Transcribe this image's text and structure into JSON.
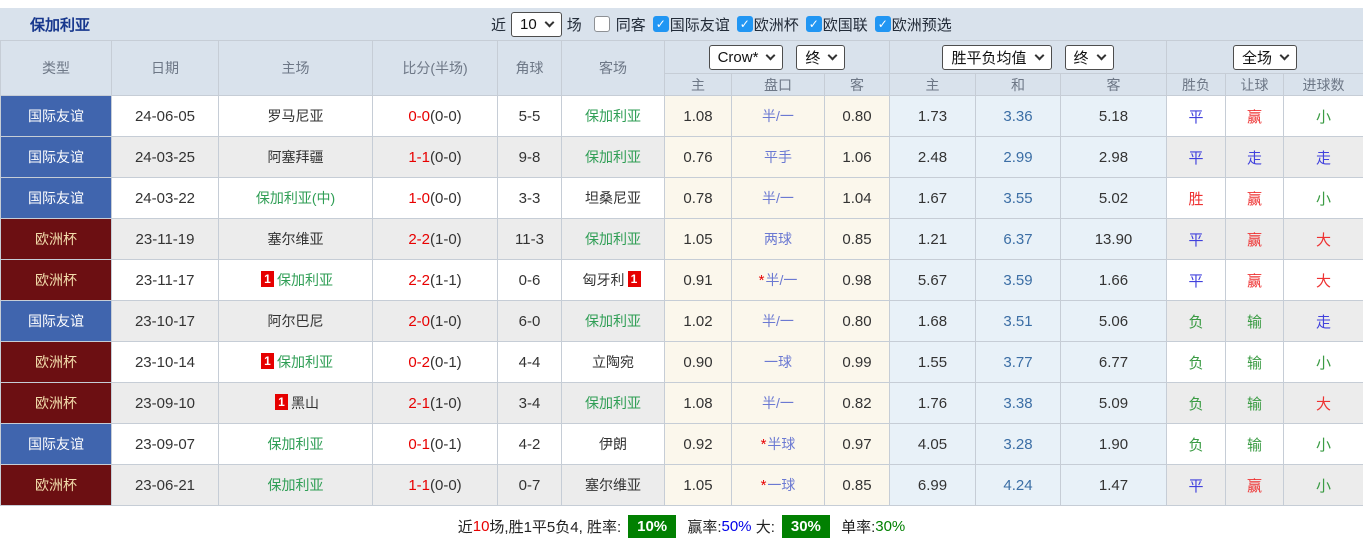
{
  "colors": {
    "type_blue": "#4065ae",
    "type_maroon": "#6c0f12",
    "type_maroon_text": "#f2dcab",
    "team_green": "#2f9e55",
    "score_red": "#e80000",
    "result_blue": "#4141dd",
    "result_red": "#ee3232",
    "result_green": "#3a9b43",
    "handicap_blue": "#6b79d2",
    "draw_blue": "#3b6ea5",
    "badge_red": "#e60000",
    "checkbox_blue": "#2196f3",
    "footer_green": "#018001",
    "footer_blue": "#0000e8",
    "title_blue": "#17378d"
  },
  "toolbar": {
    "title": "保加利亚",
    "near_label": "近",
    "matches_select": "10",
    "games_label": "场",
    "filters": [
      {
        "label": "同客",
        "checked": false
      },
      {
        "label": "国际友谊",
        "checked": true
      },
      {
        "label": "欧洲杯",
        "checked": true
      },
      {
        "label": "欧国联",
        "checked": true
      },
      {
        "label": "欧洲预选",
        "checked": true
      }
    ]
  },
  "table": {
    "headers": {
      "type": "类型",
      "date": "日期",
      "home": "主场",
      "score": "比分(半场)",
      "corner": "角球",
      "away": "客场",
      "selects": {
        "bookmaker": "Crow*",
        "time1": "终",
        "avg": "胜平负均值",
        "time2": "终",
        "scope": "全场"
      },
      "sub": [
        "主",
        "盘口",
        "客",
        "主",
        "和",
        "客",
        "胜负",
        "让球",
        "进球数"
      ]
    },
    "rows": [
      {
        "type": "国际友谊",
        "type_style": "blue",
        "date": "24-06-05",
        "home": {
          "name": "罗马尼亚",
          "green": false,
          "badge": ""
        },
        "score": {
          "full": "0-0",
          "half": "(0-0)"
        },
        "corner": "5-5",
        "away": {
          "name": "保加利亚",
          "green": true,
          "badge": ""
        },
        "crow": {
          "home": "1.08",
          "star": false,
          "handicap": "半/一",
          "away": "0.80"
        },
        "avg": {
          "home": "1.73",
          "draw": "3.36",
          "away": "5.18"
        },
        "result": {
          "wdl": "平",
          "wdl_c": "blue",
          "let": "赢",
          "let_c": "red",
          "goal": "小",
          "goal_c": "green"
        }
      },
      {
        "type": "国际友谊",
        "type_style": "blue",
        "date": "24-03-25",
        "home": {
          "name": "阿塞拜疆",
          "green": false,
          "badge": ""
        },
        "score": {
          "full": "1-1",
          "half": "(0-0)"
        },
        "corner": "9-8",
        "away": {
          "name": "保加利亚",
          "green": true,
          "badge": ""
        },
        "crow": {
          "home": "0.76",
          "star": false,
          "handicap": "平手",
          "away": "1.06"
        },
        "avg": {
          "home": "2.48",
          "draw": "2.99",
          "away": "2.98"
        },
        "result": {
          "wdl": "平",
          "wdl_c": "blue",
          "let": "走",
          "let_c": "blue",
          "goal": "走",
          "goal_c": "blue"
        }
      },
      {
        "type": "国际友谊",
        "type_style": "blue",
        "date": "24-03-22",
        "home": {
          "name": "保加利亚(中)",
          "green": true,
          "badge": ""
        },
        "score": {
          "full": "1-0",
          "half": "(0-0)"
        },
        "corner": "3-3",
        "away": {
          "name": "坦桑尼亚",
          "green": false,
          "badge": ""
        },
        "crow": {
          "home": "0.78",
          "star": false,
          "handicap": "半/一",
          "away": "1.04"
        },
        "avg": {
          "home": "1.67",
          "draw": "3.55",
          "away": "5.02"
        },
        "result": {
          "wdl": "胜",
          "wdl_c": "red",
          "let": "赢",
          "let_c": "red",
          "goal": "小",
          "goal_c": "green"
        }
      },
      {
        "type": "欧洲杯",
        "type_style": "maroon",
        "date": "23-11-19",
        "home": {
          "name": "塞尔维亚",
          "green": false,
          "badge": ""
        },
        "score": {
          "full": "2-2",
          "half": "(1-0)"
        },
        "corner": "11-3",
        "away": {
          "name": "保加利亚",
          "green": true,
          "badge": ""
        },
        "crow": {
          "home": "1.05",
          "star": false,
          "handicap": "两球",
          "away": "0.85"
        },
        "avg": {
          "home": "1.21",
          "draw": "6.37",
          "away": "13.90"
        },
        "result": {
          "wdl": "平",
          "wdl_c": "blue",
          "let": "赢",
          "let_c": "red",
          "goal": "大",
          "goal_c": "red"
        }
      },
      {
        "type": "欧洲杯",
        "type_style": "maroon",
        "date": "23-11-17",
        "home": {
          "name": "保加利亚",
          "green": true,
          "badge": "1"
        },
        "score": {
          "full": "2-2",
          "half": "(1-1)"
        },
        "corner": "0-6",
        "away": {
          "name": "匈牙利",
          "green": false,
          "badge": "1"
        },
        "crow": {
          "home": "0.91",
          "star": true,
          "handicap": "半/一",
          "away": "0.98"
        },
        "avg": {
          "home": "5.67",
          "draw": "3.59",
          "away": "1.66"
        },
        "result": {
          "wdl": "平",
          "wdl_c": "blue",
          "let": "赢",
          "let_c": "red",
          "goal": "大",
          "goal_c": "red"
        }
      },
      {
        "type": "国际友谊",
        "type_style": "blue",
        "date": "23-10-17",
        "home": {
          "name": "阿尔巴尼",
          "green": false,
          "badge": ""
        },
        "score": {
          "full": "2-0",
          "half": "(1-0)"
        },
        "corner": "6-0",
        "away": {
          "name": "保加利亚",
          "green": true,
          "badge": ""
        },
        "crow": {
          "home": "1.02",
          "star": false,
          "handicap": "半/一",
          "away": "0.80"
        },
        "avg": {
          "home": "1.68",
          "draw": "3.51",
          "away": "5.06"
        },
        "result": {
          "wdl": "负",
          "wdl_c": "green",
          "let": "输",
          "let_c": "green",
          "goal": "走",
          "goal_c": "blue"
        }
      },
      {
        "type": "欧洲杯",
        "type_style": "maroon",
        "date": "23-10-14",
        "home": {
          "name": "保加利亚",
          "green": true,
          "badge": "1"
        },
        "score": {
          "full": "0-2",
          "half": "(0-1)"
        },
        "corner": "4-4",
        "away": {
          "name": "立陶宛",
          "green": false,
          "badge": ""
        },
        "crow": {
          "home": "0.90",
          "star": false,
          "handicap": "一球",
          "away": "0.99"
        },
        "avg": {
          "home": "1.55",
          "draw": "3.77",
          "away": "6.77"
        },
        "result": {
          "wdl": "负",
          "wdl_c": "green",
          "let": "输",
          "let_c": "green",
          "goal": "小",
          "goal_c": "green"
        }
      },
      {
        "type": "欧洲杯",
        "type_style": "maroon",
        "date": "23-09-10",
        "home": {
          "name": "黑山",
          "green": false,
          "badge": "1"
        },
        "score": {
          "full": "2-1",
          "half": "(1-0)"
        },
        "corner": "3-4",
        "away": {
          "name": "保加利亚",
          "green": true,
          "badge": ""
        },
        "crow": {
          "home": "1.08",
          "star": false,
          "handicap": "半/一",
          "away": "0.82"
        },
        "avg": {
          "home": "1.76",
          "draw": "3.38",
          "away": "5.09"
        },
        "result": {
          "wdl": "负",
          "wdl_c": "green",
          "let": "输",
          "let_c": "green",
          "goal": "大",
          "goal_c": "red"
        }
      },
      {
        "type": "国际友谊",
        "type_style": "blue",
        "date": "23-09-07",
        "home": {
          "name": "保加利亚",
          "green": true,
          "badge": ""
        },
        "score": {
          "full": "0-1",
          "half": "(0-1)"
        },
        "corner": "4-2",
        "away": {
          "name": "伊朗",
          "green": false,
          "badge": ""
        },
        "crow": {
          "home": "0.92",
          "star": true,
          "handicap": "半球",
          "away": "0.97"
        },
        "avg": {
          "home": "4.05",
          "draw": "3.28",
          "away": "1.90"
        },
        "result": {
          "wdl": "负",
          "wdl_c": "green",
          "let": "输",
          "let_c": "green",
          "goal": "小",
          "goal_c": "green"
        }
      },
      {
        "type": "欧洲杯",
        "type_style": "maroon",
        "date": "23-06-21",
        "home": {
          "name": "保加利亚",
          "green": true,
          "badge": ""
        },
        "score": {
          "full": "1-1",
          "half": "(0-0)"
        },
        "corner": "0-7",
        "away": {
          "name": "塞尔维亚",
          "green": false,
          "badge": ""
        },
        "crow": {
          "home": "1.05",
          "star": true,
          "handicap": "一球",
          "away": "0.85"
        },
        "avg": {
          "home": "6.99",
          "draw": "4.24",
          "away": "1.47"
        },
        "result": {
          "wdl": "平",
          "wdl_c": "blue",
          "let": "赢",
          "let_c": "red",
          "goal": "小",
          "goal_c": "green"
        }
      }
    ]
  },
  "footer": {
    "parts": [
      {
        "text": "近",
        "style": "dark"
      },
      {
        "text": "10",
        "style": "red"
      },
      {
        "text": "场,胜1平5负4, 胜率:",
        "style": "dark"
      },
      {
        "text": "10%",
        "style": "badge-green"
      },
      {
        "text": " 赢率:",
        "style": "dark"
      },
      {
        "text": "50%",
        "style": "blue"
      },
      {
        "text": " 大:",
        "style": "dark"
      },
      {
        "text": "30%",
        "style": "badge-green"
      },
      {
        "text": " 单率:",
        "style": "dark"
      },
      {
        "text": "30%",
        "style": "green"
      }
    ]
  }
}
